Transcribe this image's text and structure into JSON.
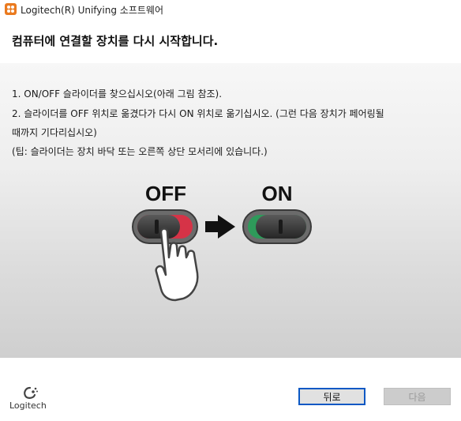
{
  "window": {
    "title": "Logitech(R) Unifying 소프트웨어"
  },
  "header": {
    "heading": "컴퓨터에 연결할 장치를 다시 시작합니다."
  },
  "instructions": [
    "1. ON/OFF 슬라이더를 찾으십시오(아래 그림 참조).",
    "2. 슬라이더를 OFF 위치로 옮겼다가 다시 ON 위치로 옮기십시오. (그런 다음 장치가 페어링될",
    "때까지 기다리십시오)",
    "(팁: 슬라이더는 장치 바닥 또는 오른쪽 상단 모서리에 있습니다.)"
  ],
  "illustration": {
    "off_label": "OFF",
    "on_label": "ON",
    "off_accent_color": "#d63347",
    "on_accent_color": "#2e9a5a"
  },
  "footer": {
    "logo_text": "Logitech",
    "back_label": "뒤로",
    "next_label": "다음"
  }
}
